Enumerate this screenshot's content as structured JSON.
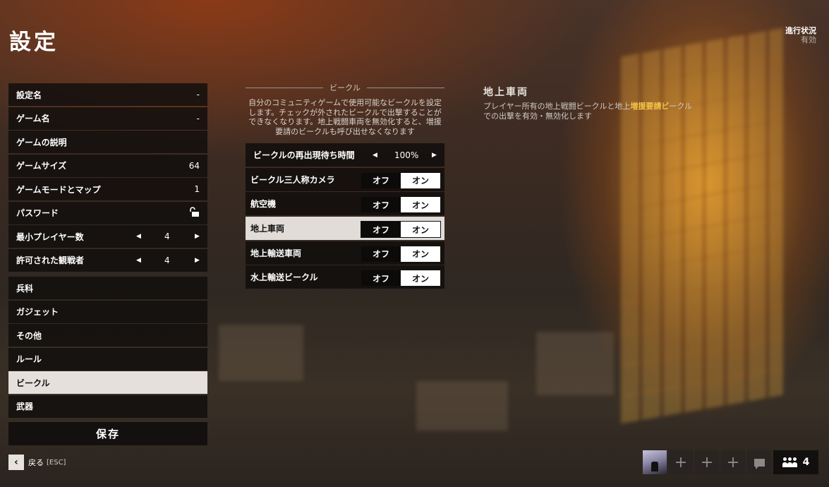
{
  "header": {
    "title": "設定",
    "progress_label": "進行状況",
    "progress_value": "有効"
  },
  "left_menu": {
    "settings_name": {
      "label": "設定名",
      "value": "-"
    },
    "game_name": {
      "label": "ゲーム名",
      "value": "-"
    },
    "game_description": {
      "label": "ゲームの説明"
    },
    "game_size": {
      "label": "ゲームサイズ",
      "value": "64"
    },
    "game_mode_map": {
      "label": "ゲームモードとマップ",
      "value": "1"
    },
    "password": {
      "label": "パスワード"
    },
    "min_players": {
      "label": "最小プレイヤー数",
      "value": "4"
    },
    "spectators": {
      "label": "許可された観戦者",
      "value": "4"
    },
    "categories": [
      "兵科",
      "ガジェット",
      "その他",
      "ルール",
      "ビークル",
      "武器"
    ],
    "selected_category": "ビークル",
    "save_label": "保存"
  },
  "vehicles": {
    "section_title": "ビークル",
    "description": "自分のコミュニティゲームで使用可能なビークルを設定します。チェックが外されたビークルで出撃することができなくなります。地上戦闘車両を無効化すると、増援要請のビークルも呼び出せなくなります",
    "respawn": {
      "label": "ビークルの再出現待ち時間",
      "value": "100%"
    },
    "toggle_off_label": "オフ",
    "toggle_on_label": "オン",
    "options": [
      {
        "label": "ビークル三人称カメラ",
        "state": "オン"
      },
      {
        "label": "航空機",
        "state": "オン"
      },
      {
        "label": "地上車両",
        "state": "オン"
      },
      {
        "label": "地上輸送車両",
        "state": "オン"
      },
      {
        "label": "水上輸送ビークル",
        "state": "オン"
      }
    ],
    "highlighted_option": "地上車両"
  },
  "info": {
    "title": "地上車両",
    "text_before": "プレイヤー所有の地上戦闘ビークルと地上",
    "text_highlight": "増援要請ビ",
    "text_after": "ークルでの出撃を有効・無効化します",
    "highlight_color": "#f3c24a"
  },
  "footer": {
    "back_label": "戻る",
    "back_key": "[ESC]",
    "party_count": "4",
    "slot_icons": [
      "plus-icon",
      "plus-icon",
      "plus-icon"
    ],
    "chat_icon": "chat-icon",
    "party_icon": "party-icon"
  }
}
